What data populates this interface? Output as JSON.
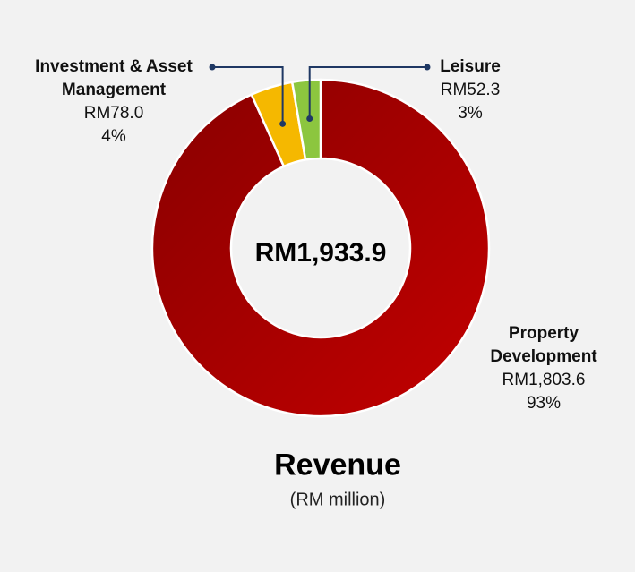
{
  "chart_data": {
    "type": "pie",
    "title": "Revenue",
    "subtitle": "(RM million)",
    "center_label": "RM1,933.9",
    "total": 1933.9,
    "unit": "RM million",
    "slices": [
      {
        "name": "Property Development",
        "value": 1803.6,
        "value_label": "RM1,803.6",
        "pct": 93,
        "pct_label": "93%",
        "color": "#b80000"
      },
      {
        "name": "Investment & Asset Management",
        "value": 78.0,
        "value_label": "RM78.0",
        "pct": 4,
        "pct_label": "4%",
        "color": "#f5b800"
      },
      {
        "name": "Leisure",
        "value": 52.3,
        "value_label": "RM52.3",
        "pct": 3,
        "pct_label": "3%",
        "color": "#8cc63f"
      }
    ],
    "legend": "none"
  },
  "labels": {
    "property_name_line1": "Property",
    "property_name_line2": "Development",
    "investment_name_line1": "Investment & Asset",
    "investment_name_line2": "Management",
    "leisure_name": "Leisure"
  },
  "colors": {
    "background": "#f2f2f2",
    "ring_dark": "#880000",
    "ring_light": "#c30000",
    "slice_border": "#ffffff",
    "leader_line": "#1f3864"
  }
}
